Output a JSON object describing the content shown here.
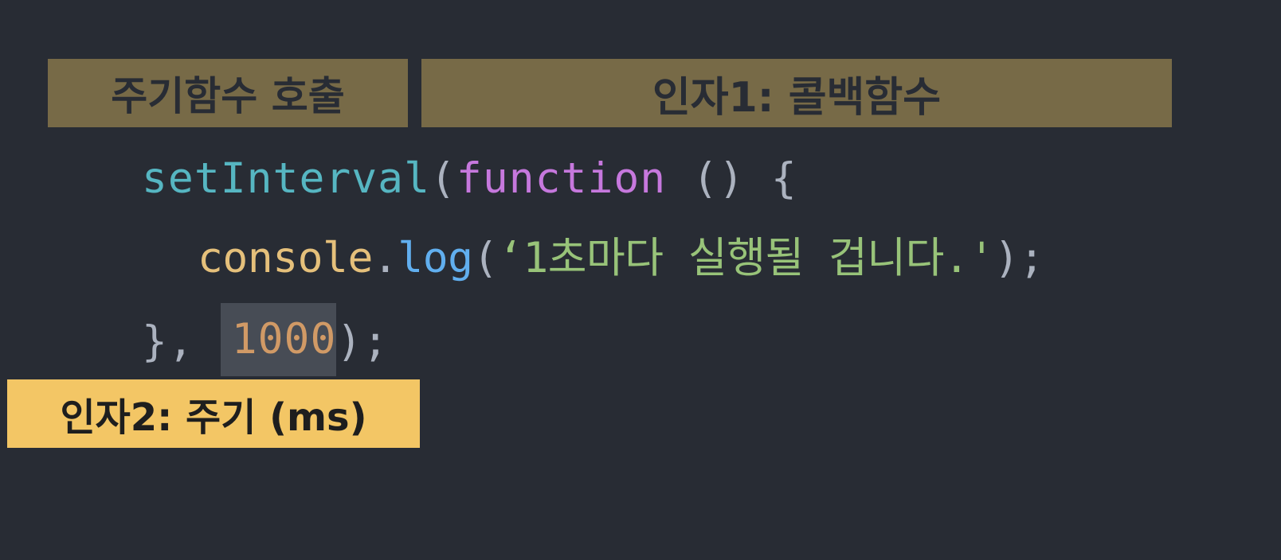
{
  "labels": {
    "call": "주기함수 호출",
    "arg1": "인자1: 콜백함수",
    "arg2": "인자2: 주기 (ms)"
  },
  "code": {
    "line1": {
      "fn": "setInterval",
      "open_paren": "(",
      "keyword": "function",
      "rest": " () {"
    },
    "line2": {
      "object": "console",
      "dot": ".",
      "method": "log",
      "open_paren": "(",
      "string": "‘1초마다 실행될 겁니다.'",
      "close": ");"
    },
    "line3": {
      "prefix": "}, ",
      "number": "1000",
      "suffix": ");"
    }
  },
  "colors": {
    "background": "#282c34",
    "label_muted": "#776a47",
    "label_highlight": "#f3c665",
    "function_name": "#56b6c2",
    "keyword": "#c678dd",
    "object": "#e5c07b",
    "method": "#61afef",
    "string": "#98c379",
    "number": "#d19a66",
    "punctuation": "#abb2bf",
    "number_highlight_bg": "#474c55"
  }
}
